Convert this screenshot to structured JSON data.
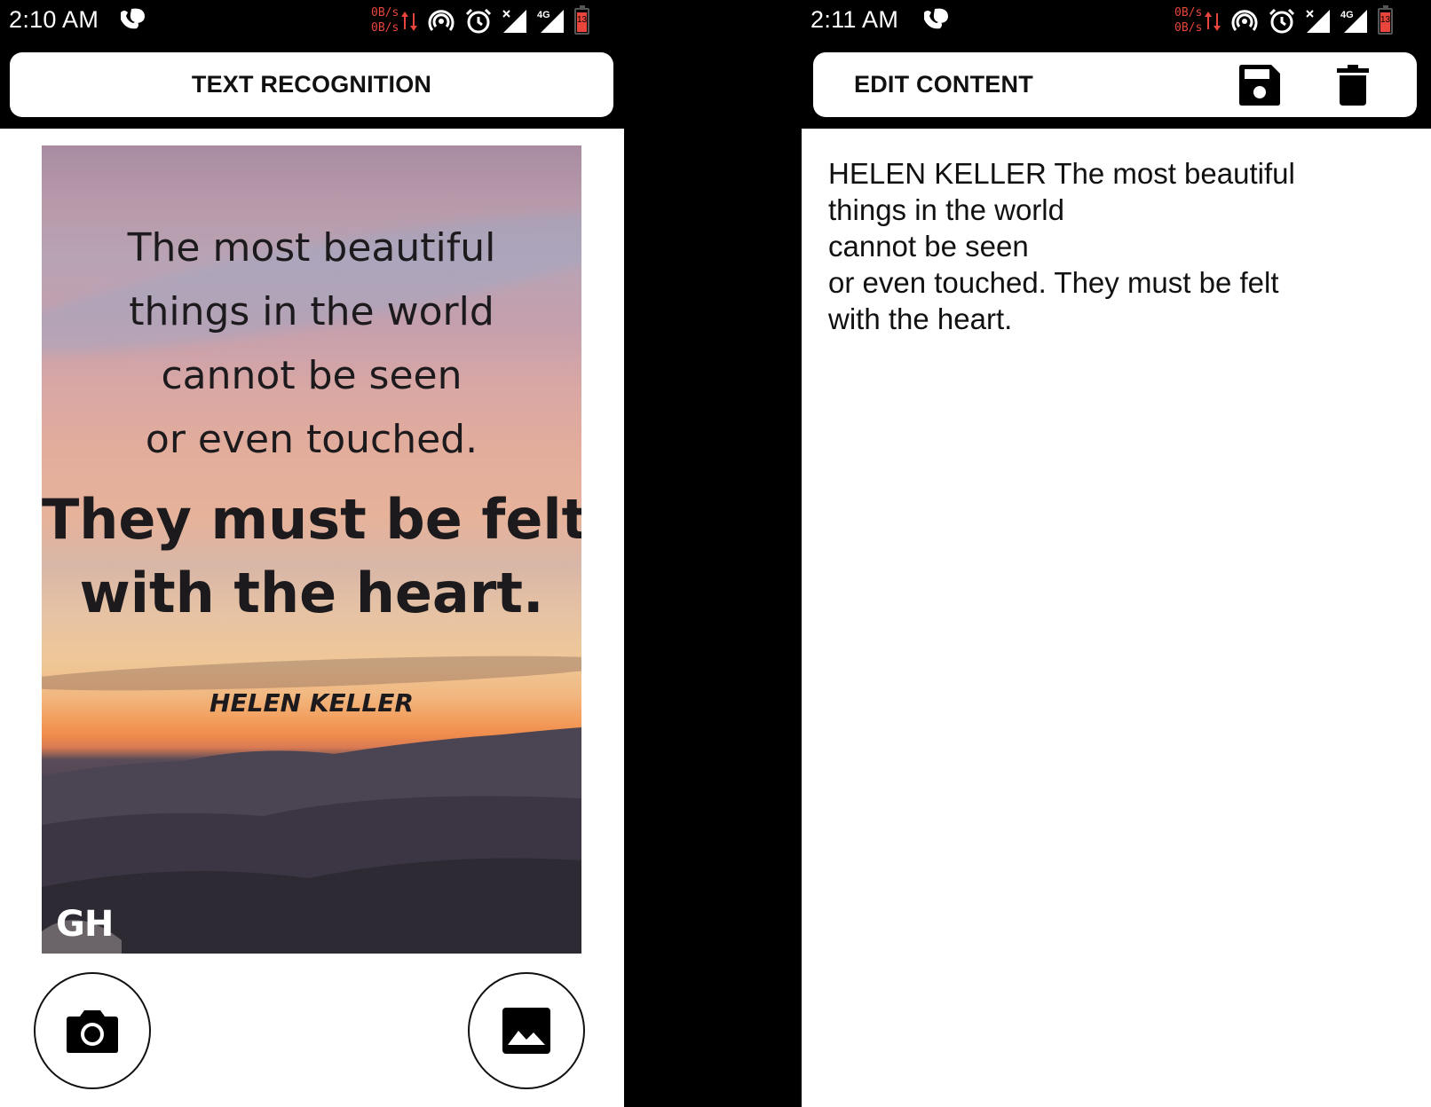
{
  "left_screen": {
    "status_bar": {
      "time": "2:10 AM",
      "net_up": "0B/s",
      "net_down": "0B/s",
      "battery_level": "13"
    },
    "title": "TEXT RECOGNITION",
    "quote_image": {
      "lines": [
        "The most beautiful",
        "things in the world",
        "cannot be seen",
        "or even touched.",
        "They must be felt",
        "with the heart."
      ],
      "author": "HELEN KELLER",
      "logo": "GH"
    },
    "buttons": {
      "camera_icon": "camera-icon",
      "gallery_icon": "image-icon"
    }
  },
  "right_screen": {
    "status_bar": {
      "time": "2:11 AM",
      "net_up": "0B/s",
      "net_down": "0B/s",
      "battery_level": "13"
    },
    "title": "EDIT CONTENT",
    "toolbar": {
      "save_icon": "save-icon",
      "delete_icon": "delete-icon"
    },
    "content_text": "HELEN KELLER The most beautiful\nthings in the world\ncannot be seen\nor even touched. They must be felt\nwith the heart."
  },
  "colors": {
    "status_accent": "#e8453c",
    "background": "#000000",
    "surface": "#ffffff"
  }
}
